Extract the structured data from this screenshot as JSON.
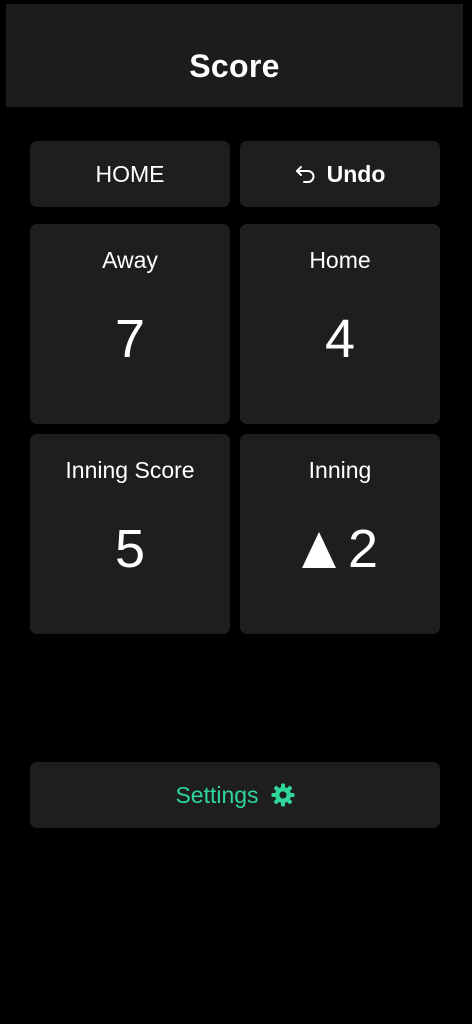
{
  "header": {
    "title": "Score"
  },
  "toolbar": {
    "side_label": "HOME",
    "undo_label": "Undo",
    "undo_icon": "undo-arrow-icon"
  },
  "cards": {
    "away": {
      "label": "Away",
      "value": "7"
    },
    "home": {
      "label": "Home",
      "value": "4"
    },
    "inning_score": {
      "label": "Inning Score",
      "value": "5"
    },
    "inning": {
      "label": "Inning",
      "half_indicator": "top",
      "half_icon": "triangle-up-icon",
      "value": "2"
    }
  },
  "settings": {
    "label": "Settings",
    "icon": "gear-icon"
  },
  "colors": {
    "background": "#000000",
    "card": "#1e1e1e",
    "header": "#1c1c1c",
    "text": "#ffffff",
    "accent": "#2ed69a"
  }
}
